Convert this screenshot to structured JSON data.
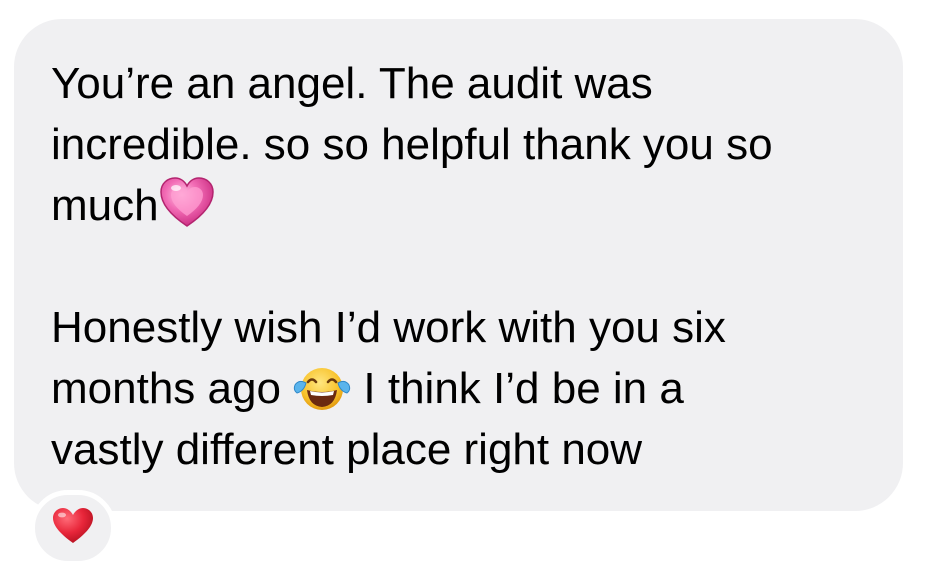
{
  "message": {
    "lines_1": [
      "You’re an angel. The audit was",
      "incredible. so so helpful thank you so",
      "much"
    ],
    "emoji_1": "sparkling-heart",
    "line_4a": "Honestly wish I’d work with you six",
    "line_5a": "months ago",
    "emoji_2": "face-with-tears-of-joy",
    "line_5b": "I think I’d be in a",
    "line_6": "vastly different place right now"
  },
  "tapback": {
    "reaction": "red-heart"
  },
  "colors": {
    "bubble": "#f0f0f2",
    "text": "#000000",
    "heart_red": "#e8263a",
    "heart_pink": "#f25aa8"
  }
}
